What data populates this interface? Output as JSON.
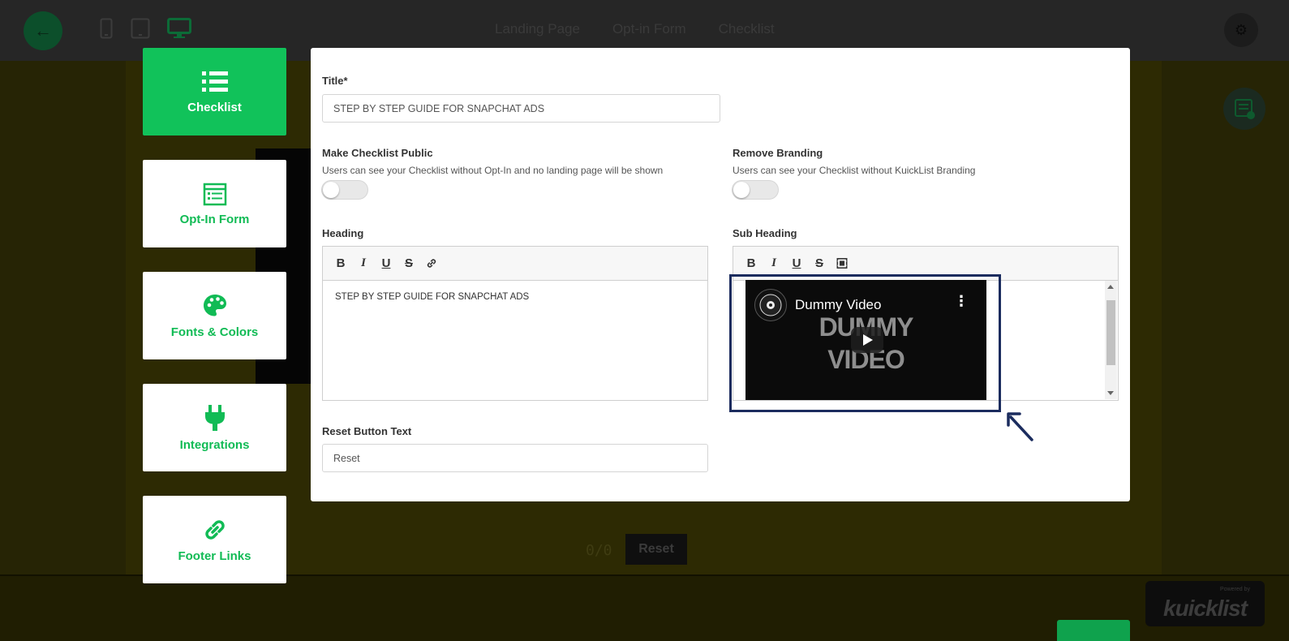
{
  "topbar": {
    "back_icon": "arrow-left-icon",
    "devices": [
      "mobile-icon",
      "tablet-icon",
      "desktop-icon"
    ],
    "nav": [
      "Landing Page",
      "Opt-in Form",
      "Checklist"
    ],
    "settings_icon": "gear-icon"
  },
  "background": {
    "counter": "0/0",
    "reset_label": "Reset",
    "powered_by": "Powered by",
    "brand": "kuicklist"
  },
  "sidebar": {
    "items": [
      {
        "label": "Checklist",
        "icon": "list-icon",
        "active": true
      },
      {
        "label": "Opt-In Form",
        "icon": "form-icon",
        "active": false
      },
      {
        "label": "Fonts & Colors",
        "icon": "palette-icon",
        "active": false
      },
      {
        "label": "Integrations",
        "icon": "plug-icon",
        "active": false
      },
      {
        "label": "Footer Links",
        "icon": "link-icon",
        "active": false
      }
    ]
  },
  "modal": {
    "title_label": "Title*",
    "title_value": "STEP BY STEP GUIDE FOR SNAPCHAT ADS",
    "public_label": "Make Checklist Public",
    "public_help": "Users can see your Checklist without Opt-In and no landing page will be shown",
    "public_on": false,
    "branding_label": "Remove Branding",
    "branding_help": "Users can see your Checklist without KuickList Branding",
    "branding_on": false,
    "heading_label": "Heading",
    "heading_toolbar": [
      "B",
      "I",
      "U",
      "S",
      "link-icon"
    ],
    "heading_value": "STEP BY STEP GUIDE FOR SNAPCHAT ADS",
    "subheading_label": "Sub Heading",
    "subheading_toolbar": [
      "B",
      "I",
      "U",
      "S",
      "video-icon"
    ],
    "video_title": "Dummy Video",
    "video_text_line1": "DUMMY",
    "video_text_line2": "VIDEO",
    "reset_label": "Reset Button Text",
    "reset_placeholder": "Reset"
  },
  "colors": {
    "accent": "#11c25a",
    "highlight": "#1b2c5e",
    "overlay_olive": "#2d2a03"
  }
}
